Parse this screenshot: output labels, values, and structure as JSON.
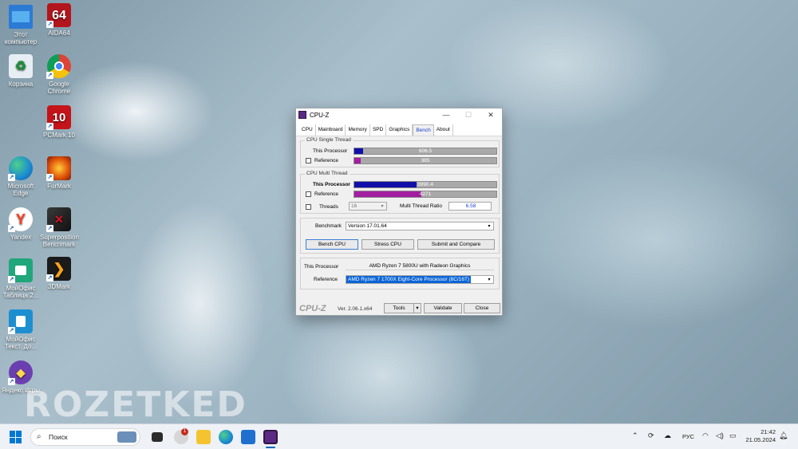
{
  "watermark": "ROZETKED",
  "desktop_icons": [
    {
      "label": "Этот компьютер",
      "color": "#2b7bd4"
    },
    {
      "label": "AIDA64",
      "color": "#b3151c",
      "glyph": "64"
    },
    {
      "label": "Корзина",
      "color": "#e7eef3"
    },
    {
      "label": "Google Chrome",
      "color": "#e8a317"
    },
    {
      "label": "PCMark 10",
      "color": "#c4141a",
      "glyph": "10"
    },
    {
      "label": "Microsoft Edge",
      "color": "#1b8ad2"
    },
    {
      "label": "FurMark",
      "color": "#c23b08"
    },
    {
      "label": "Yandex",
      "color": "#ffffff",
      "glyph": "Y"
    },
    {
      "label": "Superposition Benchmark",
      "color": "#2a2a2a"
    },
    {
      "label": "МойОфис Таблица 2...",
      "color": "#1fa67a"
    },
    {
      "label": "3DMark",
      "color": "#1b1b1b"
    },
    {
      "label": "МойОфис Текст. До...",
      "color": "#1d8fd1"
    },
    {
      "label": "Яндекс Игры",
      "color": "#6b3fb0"
    }
  ],
  "window": {
    "title": "CPU-Z",
    "minimize": "—",
    "maximize": "☐",
    "close": "✕",
    "tabs": [
      "CPU",
      "Mainboard",
      "Memory",
      "SPD",
      "Graphics",
      "Bench",
      "About"
    ],
    "active_tab": "Bench",
    "single_thread": {
      "legend": "CPU Single Thread",
      "this_label": "This Processor",
      "this_value": "606.5",
      "this_fraction": 0.06,
      "ref_label": "Reference",
      "ref_value": "385",
      "ref_fraction": 0.045
    },
    "multi_thread": {
      "legend": "CPU Multi Thread",
      "this_label": "This Processor",
      "this_value": "3990.4",
      "this_fraction": 0.44,
      "ref_label": "Reference",
      "ref_value": "4271",
      "ref_fraction": 0.47,
      "threads_label": "Threads",
      "threads_value": "16",
      "ratio_label": "Multi Thread Ratio",
      "ratio_value": "6.58"
    },
    "benchmark_label": "Benchmark",
    "benchmark_value": "Version 17.01.64",
    "bench_cpu": "Bench CPU",
    "stress_cpu": "Stress CPU",
    "submit_compare": "Submit and Compare",
    "this_processor_label": "This Processor",
    "this_processor_value": "AMD Ryzen 7 5800U with Radeon Graphics",
    "reference_label": "Reference",
    "reference_value": "AMD Ryzen 7 1700X Eight-Core Processor (8C/16T)",
    "logo": "CPU-Z",
    "version": "Ver. 2.06.1.x64",
    "tools": "Tools",
    "validate": "Validate",
    "close_btn": "Close",
    "colors": {
      "this_bar": "#1010a8",
      "ref_bar": "#a21fa0"
    }
  },
  "taskbar": {
    "search_placeholder": "Поиск",
    "notification_count": "1",
    "lang": "РУС",
    "time": "21:42",
    "date": "21.05.2024"
  }
}
